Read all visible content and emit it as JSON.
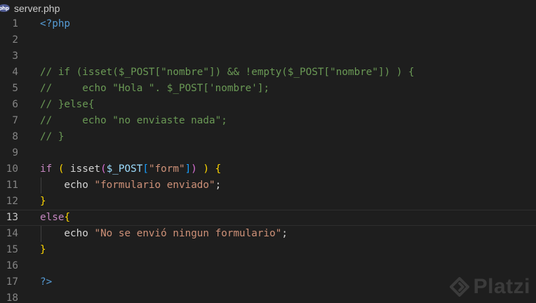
{
  "tab": {
    "icon": "php-file-icon",
    "icon_text": "php",
    "label": "server.php"
  },
  "editor": {
    "active_line": 13,
    "lines": [
      {
        "num": "1",
        "tokens": [
          {
            "t": "<?php",
            "c": "t-tag"
          }
        ]
      },
      {
        "num": "2",
        "tokens": []
      },
      {
        "num": "3",
        "tokens": []
      },
      {
        "num": "4",
        "tokens": [
          {
            "t": "// if (isset($_POST[\"nombre\"]) && !empty($_POST[\"nombre\"]) ) {",
            "c": "t-comment"
          }
        ]
      },
      {
        "num": "5",
        "tokens": [
          {
            "t": "//     echo \"Hola \". $_POST['nombre'];",
            "c": "t-comment"
          }
        ]
      },
      {
        "num": "6",
        "tokens": [
          {
            "t": "// }else{",
            "c": "t-comment"
          }
        ]
      },
      {
        "num": "7",
        "tokens": [
          {
            "t": "//     echo \"no enviaste nada\";",
            "c": "t-comment"
          }
        ]
      },
      {
        "num": "8",
        "tokens": [
          {
            "t": "// }",
            "c": "t-comment"
          }
        ]
      },
      {
        "num": "9",
        "tokens": []
      },
      {
        "num": "10",
        "tokens": [
          {
            "t": "if",
            "c": "t-keyword"
          },
          {
            "t": " ",
            "c": "t-plain"
          },
          {
            "t": "(",
            "c": "t-brace"
          },
          {
            "t": " ",
            "c": "t-plain"
          },
          {
            "t": "isset",
            "c": "t-plain"
          },
          {
            "t": "(",
            "c": "t-brace2"
          },
          {
            "t": "$_POST",
            "c": "t-var"
          },
          {
            "t": "[",
            "c": "t-brace3"
          },
          {
            "t": "\"form\"",
            "c": "t-str"
          },
          {
            "t": "]",
            "c": "t-brace3"
          },
          {
            "t": ")",
            "c": "t-brace2"
          },
          {
            "t": " ",
            "c": "t-plain"
          },
          {
            "t": ")",
            "c": "t-brace"
          },
          {
            "t": " ",
            "c": "t-plain"
          },
          {
            "t": "{",
            "c": "t-brace"
          }
        ]
      },
      {
        "num": "11",
        "tokens": [
          {
            "t": "    echo ",
            "c": "t-plain"
          },
          {
            "t": "\"formulario enviado\"",
            "c": "t-str"
          },
          {
            "t": ";",
            "c": "t-plain"
          }
        ]
      },
      {
        "num": "12",
        "tokens": [
          {
            "t": "}",
            "c": "t-brace"
          }
        ]
      },
      {
        "num": "13",
        "tokens": [
          {
            "t": "else",
            "c": "t-keyword"
          },
          {
            "t": "{",
            "c": "t-brace"
          }
        ]
      },
      {
        "num": "14",
        "tokens": [
          {
            "t": "    echo ",
            "c": "t-plain"
          },
          {
            "t": "\"No se envió ningun formulario\"",
            "c": "t-str"
          },
          {
            "t": ";",
            "c": "t-plain"
          }
        ]
      },
      {
        "num": "15",
        "tokens": [
          {
            "t": "}",
            "c": "t-brace"
          }
        ]
      },
      {
        "num": "16",
        "tokens": []
      },
      {
        "num": "17",
        "tokens": [
          {
            "t": "?>",
            "c": "t-tag"
          }
        ]
      },
      {
        "num": "18",
        "tokens": []
      }
    ]
  },
  "watermark": {
    "icon": "platzi-logo-icon",
    "text": "Platzi"
  }
}
